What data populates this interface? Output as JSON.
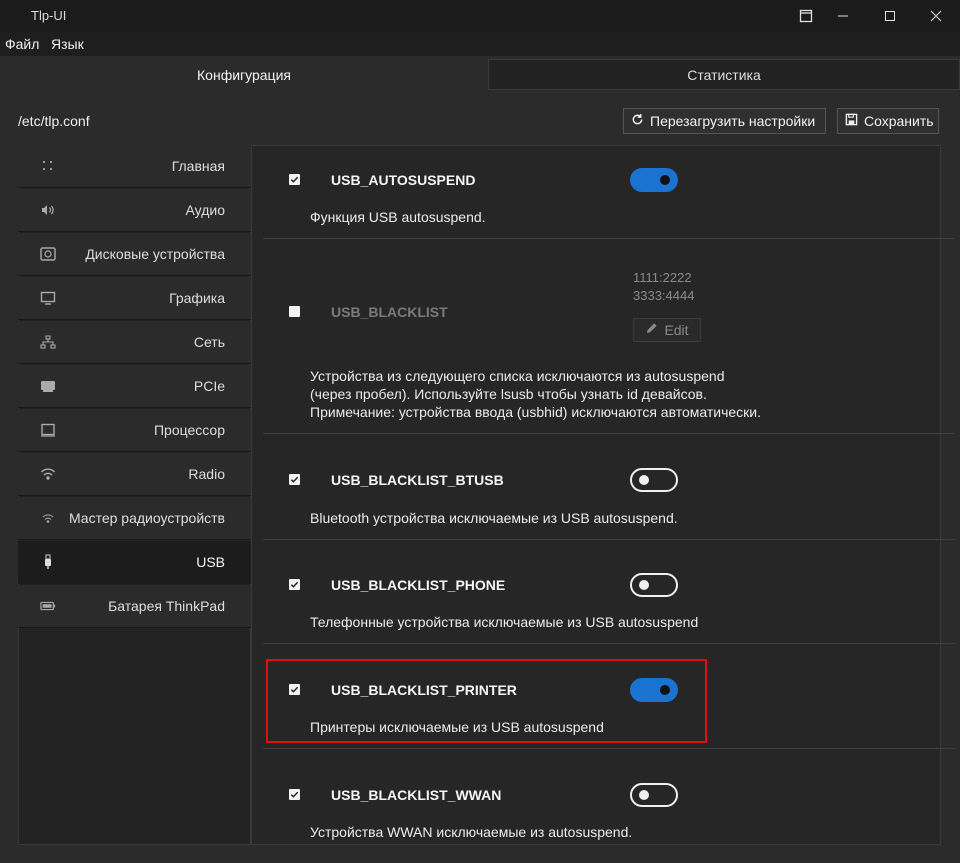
{
  "window": {
    "title": "Tlp-UI"
  },
  "menu": [
    "Файл",
    "Язык"
  ],
  "tabs": [
    {
      "label": "Конфигурация",
      "active": true
    },
    {
      "label": "Статистика",
      "active": false
    }
  ],
  "toolbar": {
    "path": "/etc/tlp.conf",
    "reload_label": "Перезагрузить настройки",
    "save_label": "Сохранить"
  },
  "sidebar": {
    "items": [
      {
        "label": "Главная",
        "icon": "dots-grid-icon"
      },
      {
        "label": "Аудио",
        "icon": "speaker-icon"
      },
      {
        "label": "Дисковые устройства",
        "icon": "disk-icon"
      },
      {
        "label": "Графика",
        "icon": "monitor-icon"
      },
      {
        "label": "Сеть",
        "icon": "network-icon"
      },
      {
        "label": "PCIe",
        "icon": "pcie-card-icon"
      },
      {
        "label": "Процессор",
        "icon": "cpu-icon"
      },
      {
        "label": "Radio",
        "icon": "wifi-icon"
      },
      {
        "label": "Мастер радиоустройств",
        "icon": "radio-wizard-icon"
      },
      {
        "label": "USB",
        "icon": "usb-icon",
        "active": true
      },
      {
        "label": "Батарея ThinkPad",
        "icon": "battery-icon"
      }
    ]
  },
  "settings": {
    "autosuspend": {
      "name": "USB_AUTOSUSPEND",
      "checked": true,
      "enabled": true,
      "desc": "Функция USB autosuspend."
    },
    "blacklist": {
      "name": "USB_BLACKLIST",
      "checked": false,
      "values": [
        "1111:2222",
        "3333:4444"
      ],
      "edit_label": "Edit",
      "desc_lines": [
        "Устройства из следующего списка исключаются из autosuspend",
        "(через пробел). Используйте lsusb чтобы узнать id девайсов.",
        "Примечание: устройства ввода (usbhid) исключаются автоматически."
      ]
    },
    "btusb": {
      "name": "USB_BLACKLIST_BTUSB",
      "checked": true,
      "enabled": false,
      "desc": "Bluetooth устройства исключаемые из USB autosuspend."
    },
    "phone": {
      "name": "USB_BLACKLIST_PHONE",
      "checked": true,
      "enabled": false,
      "desc": "Телефонные устройства исключаемые из USB autosuspend"
    },
    "printer": {
      "name": "USB_BLACKLIST_PRINTER",
      "checked": true,
      "enabled": true,
      "desc": "Принтеры исключаемые из USB autosuspend"
    },
    "wwan": {
      "name": "USB_BLACKLIST_WWAN",
      "checked": true,
      "enabled": false,
      "desc": "Устройства WWAN исключаемые из autosuspend."
    }
  },
  "colors": {
    "accent": "#1a73d1",
    "highlight_border": "#e01010"
  }
}
